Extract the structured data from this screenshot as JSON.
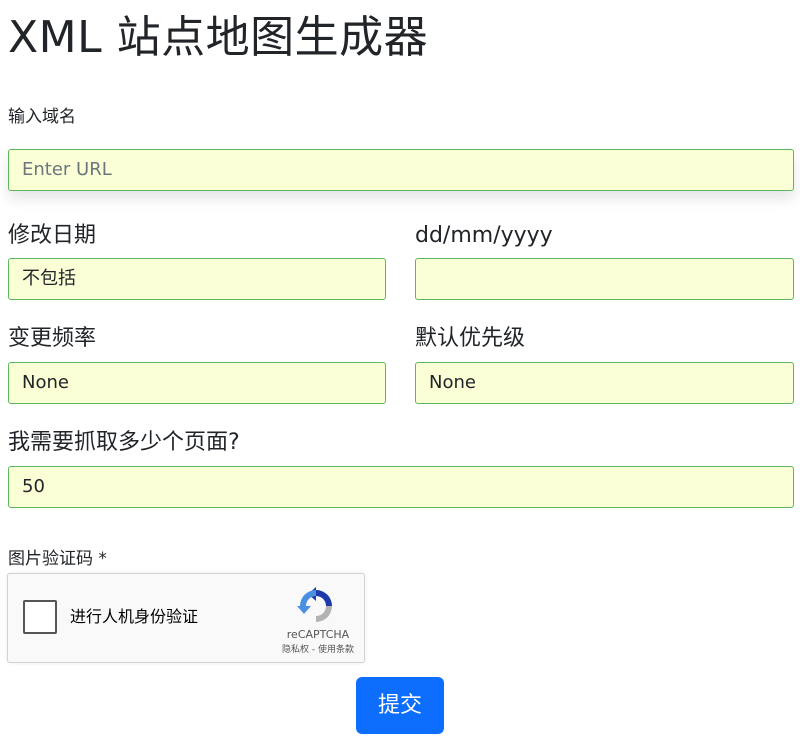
{
  "title": "XML 站点地图生成器",
  "domain_field": {
    "label": "输入域名",
    "placeholder": "Enter URL",
    "value": ""
  },
  "modified_date": {
    "label": "修改日期",
    "value": "不包括"
  },
  "date_format": {
    "label": "dd/mm/yyyy",
    "value": ""
  },
  "change_frequency": {
    "label": "变更频率",
    "value": "None"
  },
  "default_priority": {
    "label": "默认优先级",
    "value": "None"
  },
  "pages_to_crawl": {
    "label": "我需要抓取多少个页面?",
    "value": "50"
  },
  "captcha": {
    "label": "图片验证码 *",
    "checkbox_label": "进行人机身份验证",
    "brand": "reCAPTCHA",
    "terms": "隐私权 - 使用条款",
    "colors": {
      "arrow_blue": "#1c3aa9",
      "arrow_light": "#4a90e2",
      "arrow_gray": "#b3b3b3"
    }
  },
  "submit_label": "提交",
  "colors": {
    "field_bg": "#fbffd6",
    "field_border": "#5cb85c",
    "primary": "#0d6efd"
  }
}
